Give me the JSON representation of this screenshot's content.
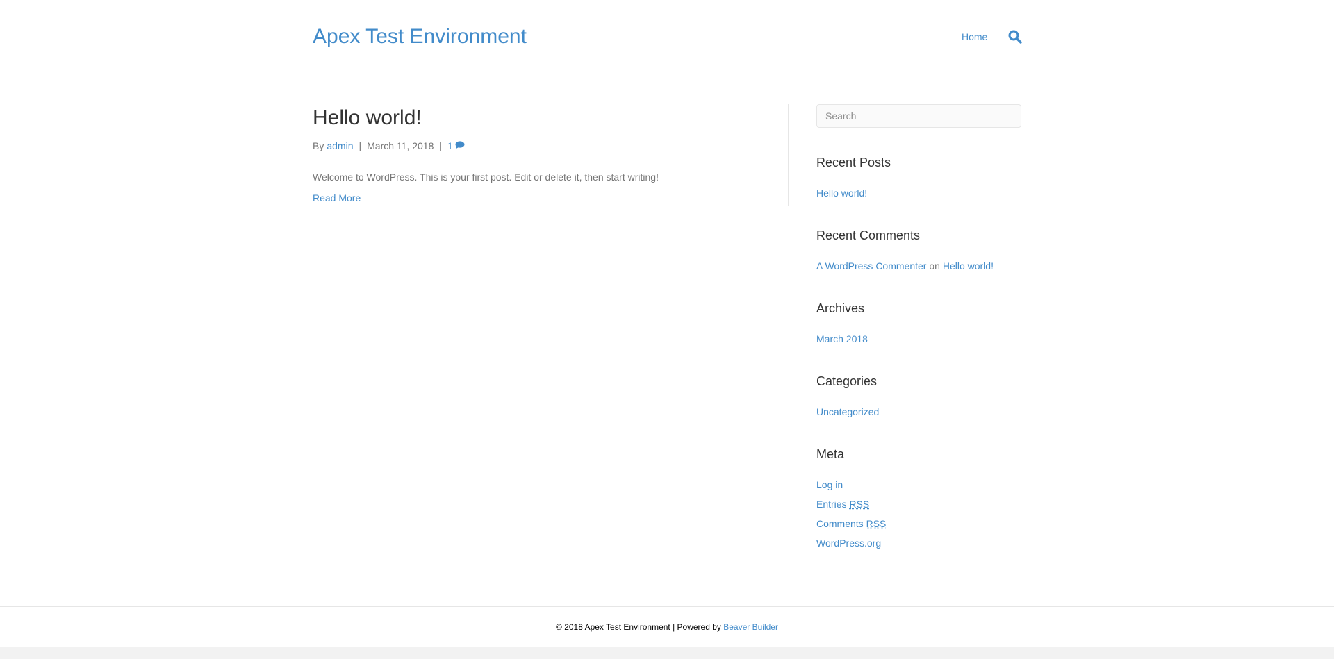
{
  "header": {
    "site_title": "Apex Test Environment",
    "nav": [
      {
        "label": "Home"
      }
    ],
    "search_icon": "search-icon"
  },
  "post": {
    "title": "Hello world!",
    "meta": {
      "by_label": "By",
      "author": "admin",
      "separator": "|",
      "date": "March 11, 2018",
      "comment_count": "1",
      "comment_icon": "comment-icon"
    },
    "excerpt": "Welcome to WordPress. This is your first post. Edit or delete it, then start writing!",
    "read_more": "Read More"
  },
  "sidebar": {
    "search": {
      "placeholder": "Search"
    },
    "recent_posts": {
      "title": "Recent Posts",
      "items": [
        "Hello world!"
      ]
    },
    "recent_comments": {
      "title": "Recent Comments",
      "items": [
        {
          "author": "A WordPress Commenter",
          "on": "on",
          "post": "Hello world!"
        }
      ]
    },
    "archives": {
      "title": "Archives",
      "items": [
        "March 2018"
      ]
    },
    "categories": {
      "title": "Categories",
      "items": [
        "Uncategorized"
      ]
    },
    "meta": {
      "title": "Meta",
      "items": {
        "login": "Log in",
        "entries": "Entries",
        "comments": "Comments",
        "rss": "RSS",
        "wordpress_org": "WordPress.org"
      }
    }
  },
  "footer": {
    "copyright": "© 2018 Apex Test Environment | Powered by",
    "powered_by_link": "Beaver Builder"
  },
  "colors": {
    "accent": "#428bca",
    "heading": "#333333",
    "body_text": "#757575",
    "border": "#e6e6e6"
  }
}
